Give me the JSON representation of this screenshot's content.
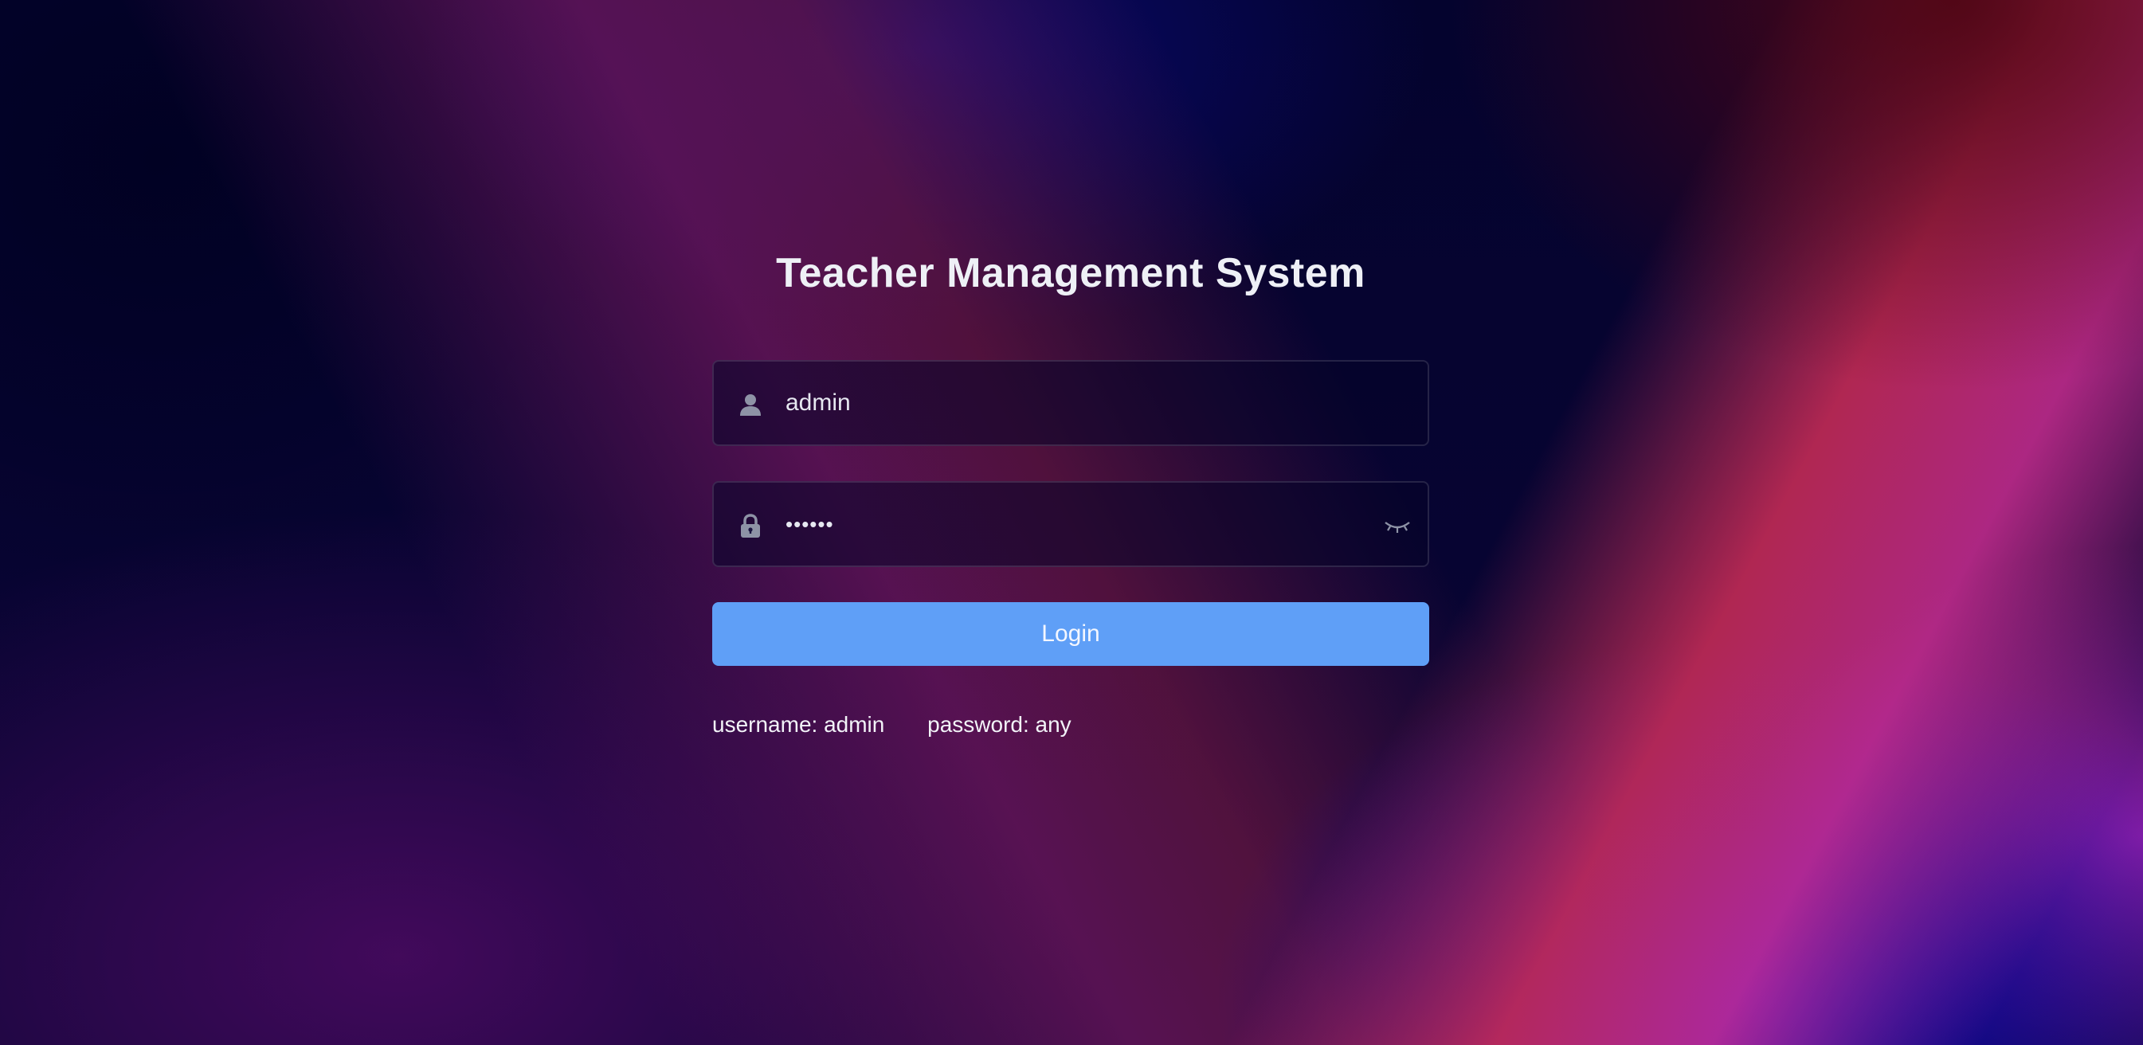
{
  "page": {
    "title": "Teacher Management System"
  },
  "form": {
    "username": {
      "value": "admin",
      "icon": "user-icon"
    },
    "password": {
      "value": "••••••",
      "icon": "lock-icon",
      "toggle_icon": "eye-closed-icon"
    },
    "login_label": "Login"
  },
  "hints": {
    "username": "username: admin",
    "password": "password: any"
  },
  "colors": {
    "button": "#5f9ff7",
    "title_text": "#eef0f6",
    "icon": "#8e93a6"
  }
}
